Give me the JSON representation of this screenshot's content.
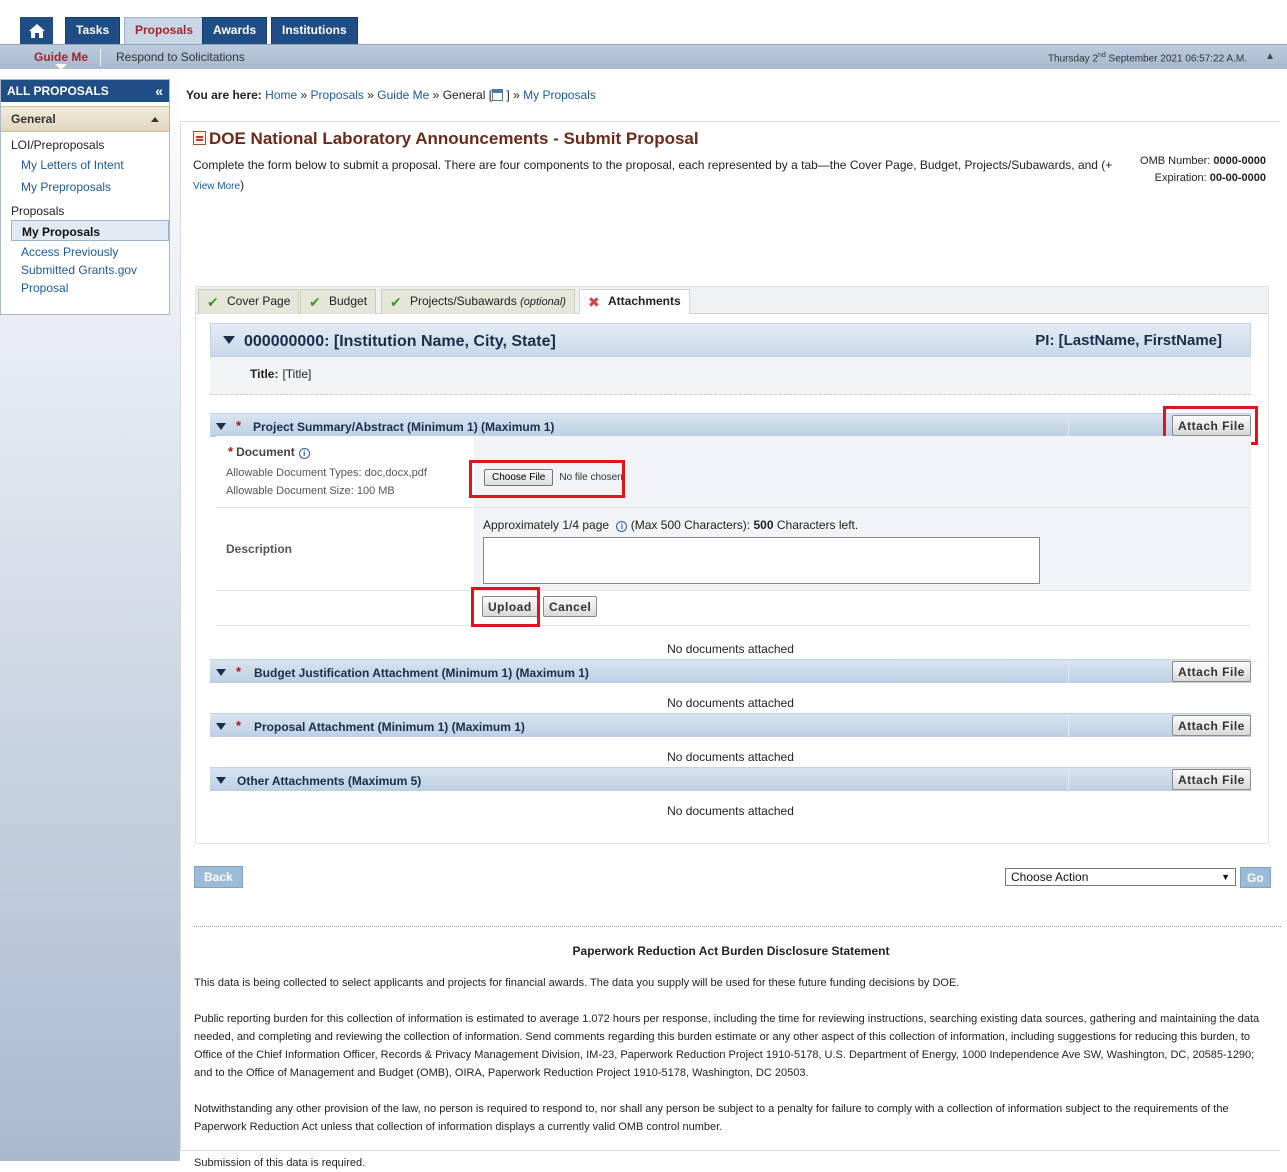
{
  "nav": {
    "tabs": [
      {
        "label": "Tasks"
      },
      {
        "label": "Proposals"
      },
      {
        "label": "Awards"
      },
      {
        "label": "Institutions"
      }
    ],
    "sub": {
      "guide_me": "Guide Me",
      "respond": "Respond to Solicitations",
      "date_prefix": "Thursday 2",
      "date_sup": "nd",
      "date_suffix": " September 2021 06:57:22 A.M."
    }
  },
  "sidebar": {
    "header": "ALL PROPOSALS",
    "collapse_glyph": "«",
    "section": "General",
    "group1": "LOI/Preproposals",
    "items1": [
      "My Letters of Intent",
      "My Preproposals"
    ],
    "group2": "Proposals",
    "items2": [
      "My Proposals",
      "Access Previously Submitted Grants.gov Proposal"
    ]
  },
  "breadcrumb": {
    "label": "You are here:",
    "home": "Home",
    "proposals": "Proposals",
    "guide_me": "Guide Me",
    "general": "General [",
    "close": "]",
    "my_proposals": "My Proposals",
    "sep": "»"
  },
  "page": {
    "title": "DOE National Laboratory Announcements - Submit Proposal",
    "intro": "Complete the form below to submit a proposal. There are four components to the proposal, each represented by a tab—the Cover Page, Budget, Projects/Subawards, and (+",
    "view_more": "View More",
    "view_more_close": ")",
    "omb_label": "OMB Number:",
    "omb_value": "0000-0000",
    "exp_label": "Expiration:",
    "exp_value": "00-00-0000"
  },
  "tabs": [
    {
      "label": "Cover Page",
      "optional": ""
    },
    {
      "label": "Budget",
      "optional": ""
    },
    {
      "label": "Projects/Subawards",
      "optional": "(optional)"
    },
    {
      "label": "Attachments",
      "optional": ""
    }
  ],
  "institution": {
    "name": "000000000: [Institution Name, City, State]",
    "pi": "PI: [LastName, FirstName]",
    "title_label": "Title:",
    "title_value": "[Title]"
  },
  "sections": [
    {
      "label": "Project Summary/Abstract (Minimum 1) (Maximum 1)",
      "required": true,
      "button": "Attach File",
      "empty": "No documents attached"
    },
    {
      "label": "Budget Justification Attachment (Minimum 1) (Maximum 1)",
      "required": true,
      "button": "Attach File",
      "empty": "No documents attached"
    },
    {
      "label": "Proposal Attachment (Minimum 1) (Maximum 1)",
      "required": true,
      "button": "Attach File",
      "empty": "No documents attached"
    },
    {
      "label": "Other Attachments (Maximum 5)",
      "required": false,
      "button": "Attach File",
      "empty": "No documents attached"
    }
  ],
  "upload_form": {
    "document_label": "Document",
    "types": "Allowable Document Types: doc,docx,pdf",
    "size": "Allowable Document Size: 100 MB",
    "choose_file": "Choose File",
    "no_file": "No file chosen",
    "description_label": "Description",
    "hint_prefix": "Approximately 1/4 page",
    "hint_mid": "(Max 500 Characters):",
    "chars_left": "500",
    "hint_suffix": "Characters left.",
    "upload": "Upload",
    "cancel": "Cancel"
  },
  "footer": {
    "back": "Back",
    "action_selected": "Choose Action",
    "go": "Go",
    "pra_title": "Paperwork Reduction Act Burden Disclosure Statement",
    "paragraphs": [
      "This data is being collected to select applicants and projects for financial awards. The data you supply will be used for these future funding decisions by DOE.",
      "Public reporting burden for this collection of information is estimated to average 1.072 hours per response, including the time for reviewing instructions, searching existing data sources, gathering and maintaining the data needed, and completing and reviewing the collection of information. Send comments regarding this burden estimate or any other aspect of this collection of information, including suggestions for reducing this burden, to Office of the Chief Information Officer, Records & Privacy Management Division, IM-23, Paperwork Reduction Project 1910-5178, U.S. Department of Energy, 1000 Independence Ave SW, Washington, DC, 20585-1290; and to the Office of Management and Budget (OMB), OIRA, Paperwork Reduction Project 1910-5178, Washington, DC 20503.",
      "Notwithstanding any other provision of the law, no person is required to respond to, nor shall any person be subject to a penalty for failure to comply with a collection of information subject to the requirements of the Paperwork Reduction Act unless that collection of information displays a currently valid OMB control number.",
      "Submission of this data is required."
    ]
  },
  "colors": {
    "nav_blue": "#1f4e87",
    "accent_red": "#a0262b",
    "highlight": "#e0141e"
  }
}
